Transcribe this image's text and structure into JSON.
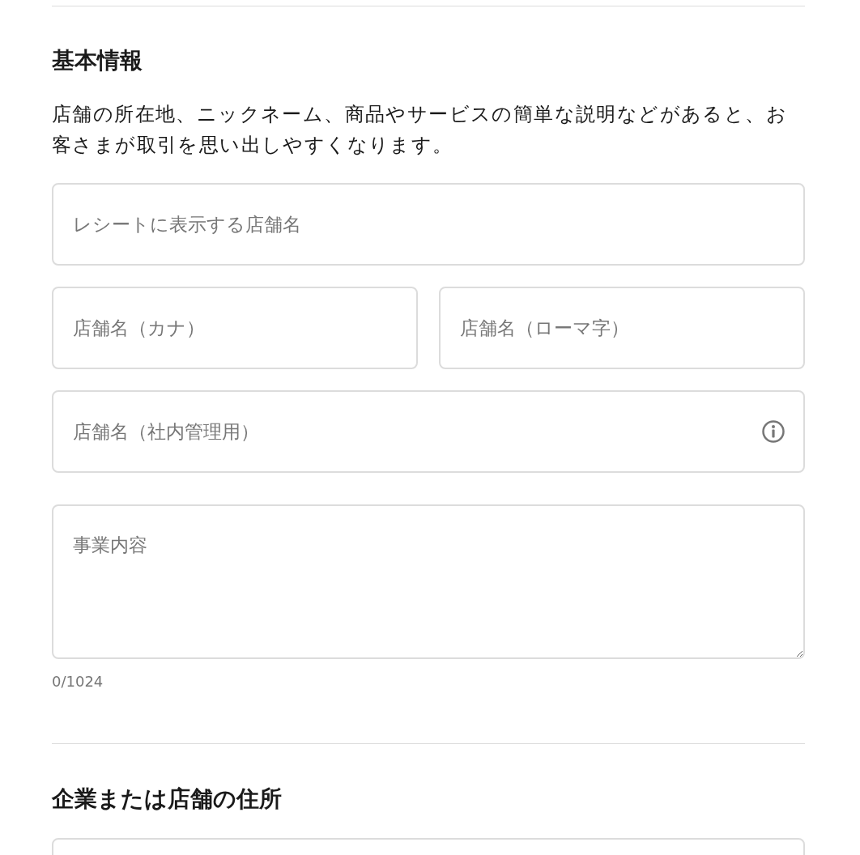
{
  "sections": [
    {
      "heading": "基本情報",
      "description": "店舗の所在地、ニックネーム、商品やサービスの簡単な説明などがあると、お客さまが取引を思い出しやすくなります。",
      "rows": [
        [
          {
            "kind": "text",
            "placeholder": "レシートに表示する店舗名"
          }
        ],
        [
          {
            "kind": "text",
            "placeholder": "店舗名（カナ）"
          },
          {
            "kind": "text",
            "placeholder": "店舗名（ローマ字）"
          }
        ],
        [
          {
            "kind": "text",
            "placeholder": "店舗名（社内管理用）",
            "info_icon": true
          }
        ],
        [
          {
            "kind": "textarea",
            "placeholder": "事業内容",
            "counter": "0/1024"
          }
        ]
      ]
    },
    {
      "heading": "企業または店舗の住所",
      "rows": [
        [
          {
            "kind": "text"
          }
        ]
      ]
    }
  ]
}
